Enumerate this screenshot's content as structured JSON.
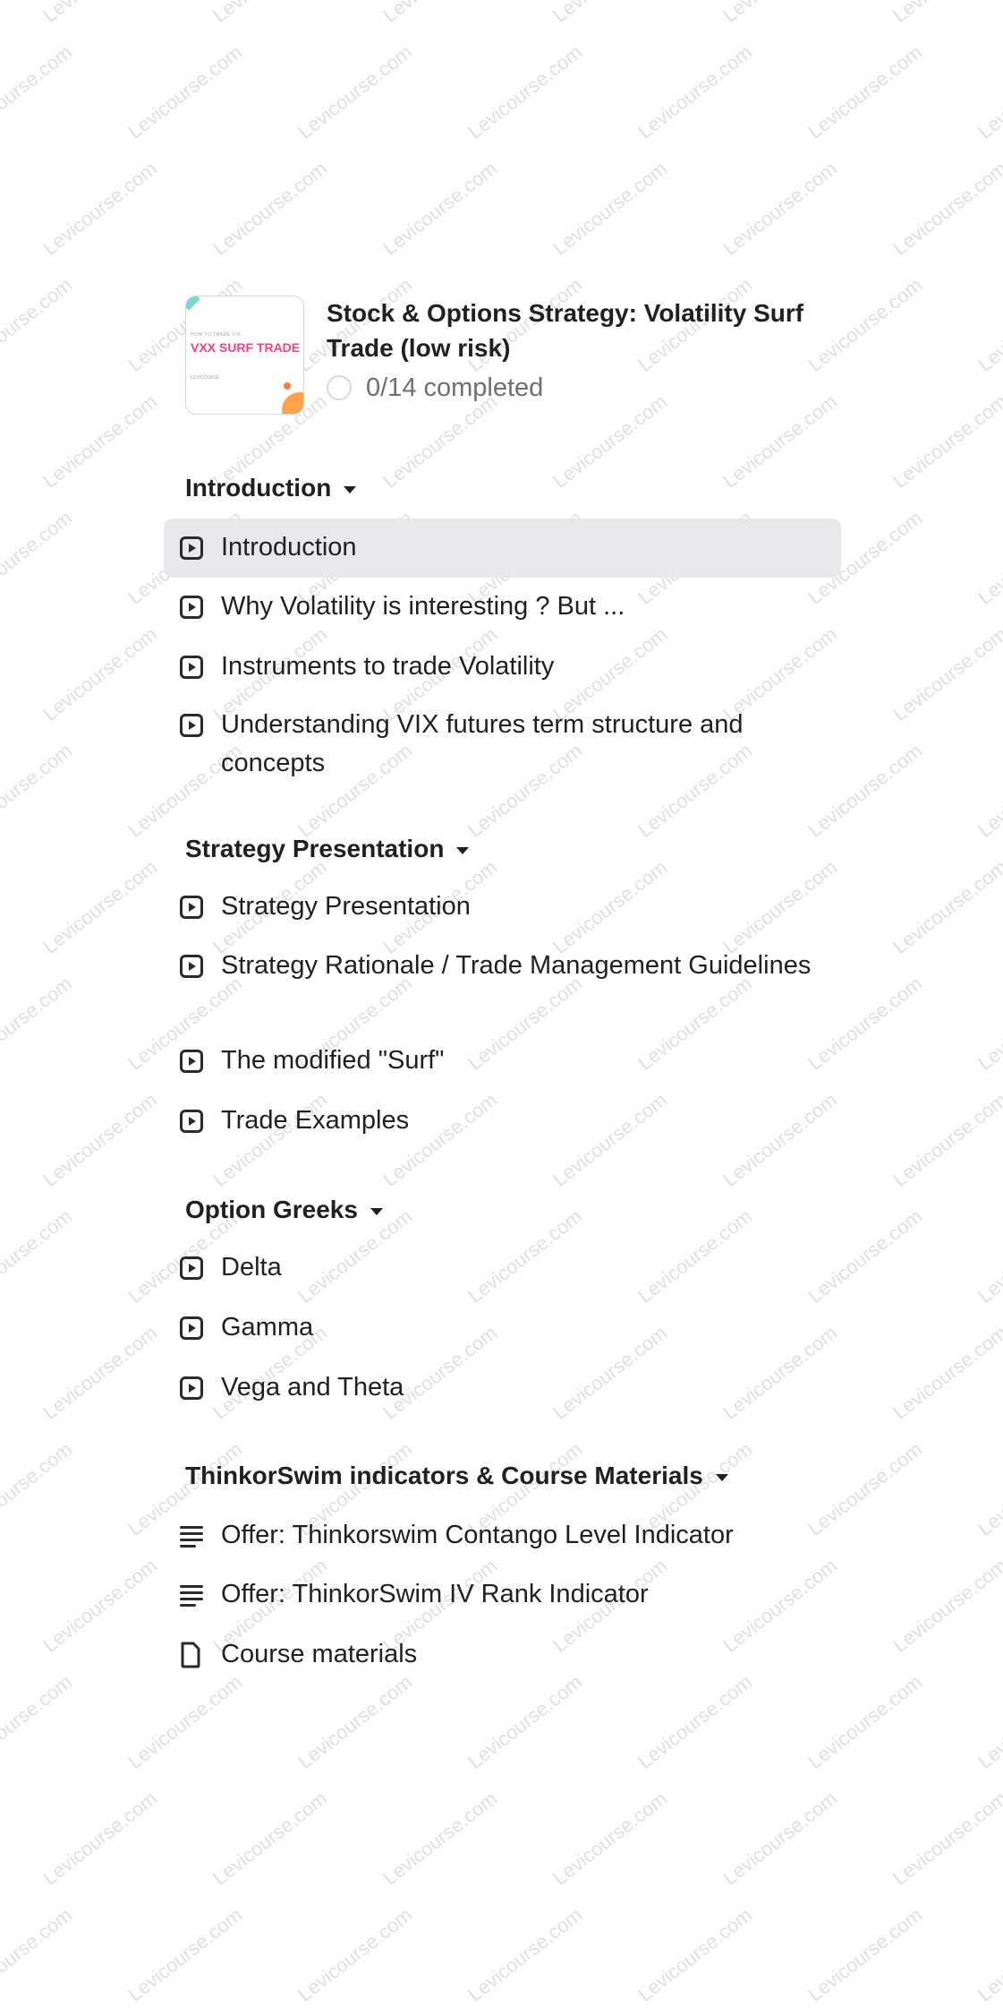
{
  "course": {
    "thumbnail": {
      "kicker": "HOW TO TRADE VIX",
      "title": "VXX SURF TRADE",
      "footer": "LEVICOURSE"
    },
    "title": "Stock & Options Strategy: Volatility Surf Trade (low risk)",
    "progress": "0/14 completed"
  },
  "sections": [
    {
      "title": "Introduction",
      "items": [
        {
          "label": "Introduction",
          "icon": "video-icon",
          "active": true
        },
        {
          "label": "Why Volatility is interesting ? But ...",
          "icon": "video-icon"
        },
        {
          "label": "Instruments to trade Volatility",
          "icon": "video-icon"
        },
        {
          "label": "Understanding VIX futures term structure and concepts",
          "icon": "video-icon"
        }
      ]
    },
    {
      "title": "Strategy Presentation",
      "items": [
        {
          "label": "Strategy Presentation",
          "icon": "video-icon"
        },
        {
          "label": "Strategy Rationale / Trade Management Guidelines",
          "icon": "video-icon"
        },
        {
          "label": "The modified \"Surf\"",
          "icon": "video-icon"
        },
        {
          "label": "Trade Examples",
          "icon": "video-icon"
        }
      ]
    },
    {
      "title": "Option Greeks",
      "items": [
        {
          "label": "Delta",
          "icon": "video-icon"
        },
        {
          "label": "Gamma",
          "icon": "video-icon"
        },
        {
          "label": "Vega and Theta",
          "icon": "video-icon"
        }
      ]
    },
    {
      "title": "ThinkorSwim indicators & Course Materials",
      "items": [
        {
          "label": "Offer: Thinkorswim Contango Level Indicator",
          "icon": "text-lines-icon"
        },
        {
          "label": "Offer: ThinkorSwim IV Rank Indicator",
          "icon": "text-lines-icon"
        },
        {
          "label": "Course materials",
          "icon": "file-icon"
        }
      ]
    }
  ],
  "watermark": {
    "text": "Levicourse.com"
  },
  "colors": {
    "active_row": "#e8e8ea",
    "thumbnail_accent": "#ff3d7f",
    "text": "#1f1f24",
    "muted": "#6f6f73"
  }
}
